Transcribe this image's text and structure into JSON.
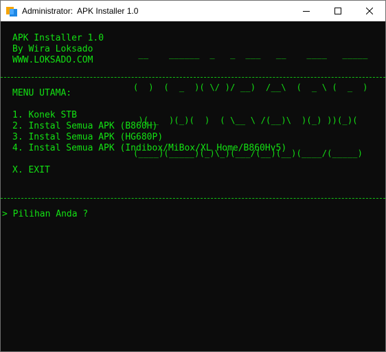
{
  "window": {
    "title": "Administrator:  APK Installer 1.0",
    "icon": "console-app-icon",
    "controls": {
      "minimize_icon": "minimize-icon",
      "maximize_icon": "maximize-icon",
      "close_icon": "close-icon"
    }
  },
  "header": {
    "app_name": "APK Installer 1.0",
    "author": "By Wira Loksado",
    "website": "WWW.LOKSADO.COM",
    "ascii_art": [
      " __    ______  _   _  ___   __    ____   _____",
      "(  )  (  _  )( \\/ )/ __)  /__\\  (  _ \\ (  _  )",
      " )(__  )(_)(  )  ( \\__ \\ /(__)\\  )(_) ))(_)(",
      "(____)(_____)(_)\\_)(___/(__)(__)(____/(_____)"
    ]
  },
  "menu": {
    "heading": "MENU UTAMA:",
    "items": [
      "1. Konek STB",
      "2. Instal Semua APK (B860H)",
      "3. Instal Semua APK (HG680P)",
      "4. Instal Semua APK (Indibox/MiBox/XL Home/B860Hv5)"
    ],
    "exit": "X. EXIT"
  },
  "prompt": {
    "text": "> Pilihan Anda ?"
  },
  "colors": {
    "console_bg": "#0c0c0c",
    "console_text": "#13e113",
    "titlebar_bg": "#ffffff"
  }
}
